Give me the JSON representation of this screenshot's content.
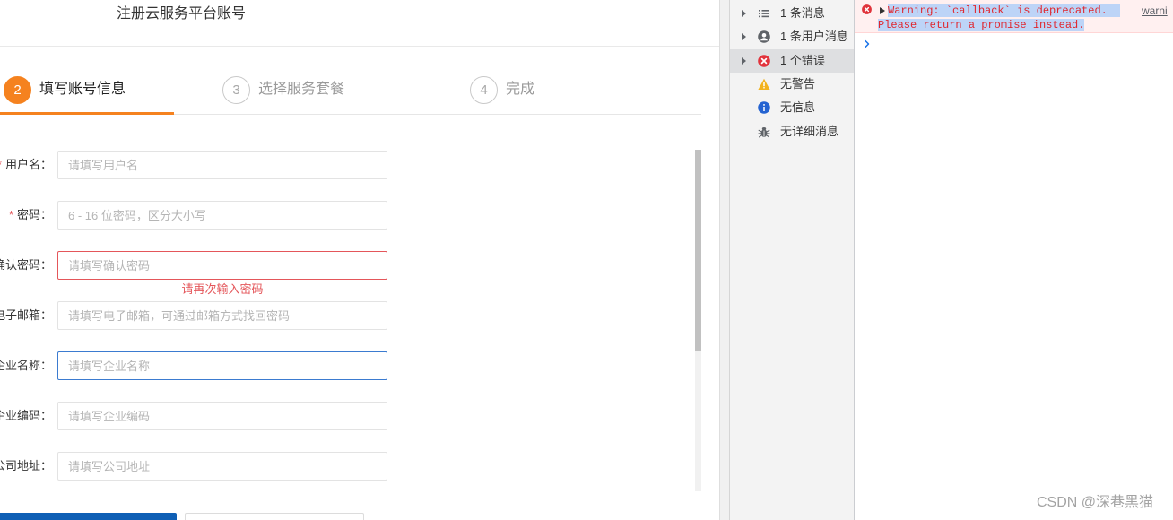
{
  "register": {
    "title": "注册云服务平台账号",
    "steps": [
      {
        "number": "2",
        "label": "填写账号信息",
        "active": true
      },
      {
        "number": "3",
        "label": "选择服务套餐",
        "active": false
      },
      {
        "number": "4",
        "label": "完成",
        "active": false
      }
    ],
    "required_mark": "*",
    "fields": [
      {
        "label": "用户名：",
        "required": true,
        "placeholder": "请填写用户名",
        "value": "",
        "has_error": false,
        "focused": false
      },
      {
        "label": "密码：",
        "required": true,
        "placeholder": "6 - 16 位密码，区分大小写",
        "value": "",
        "has_error": false,
        "focused": false
      },
      {
        "label": "确认密码：",
        "required": false,
        "placeholder": "请填写确认密码",
        "value": "",
        "has_error": true,
        "focused": false,
        "error_text": "请再次输入密码"
      },
      {
        "label": "电子邮箱：",
        "required": false,
        "placeholder": "请填写电子邮箱，可通过邮箱方式找回密码",
        "value": "",
        "has_error": false,
        "focused": false
      },
      {
        "label": "企业名称：",
        "required": false,
        "placeholder": "请填写企业名称",
        "value": "",
        "has_error": false,
        "focused": true
      },
      {
        "label": "企业编码：",
        "required": false,
        "placeholder": "请填写企业编码",
        "value": "",
        "has_error": false,
        "focused": false
      },
      {
        "label": "公司地址：",
        "required": false,
        "placeholder": "请填写公司地址",
        "value": "",
        "has_error": false,
        "focused": false
      }
    ]
  },
  "devtools": {
    "sidebar": [
      {
        "label": "1 条消息",
        "icon": "list-icon",
        "expandable": true,
        "selected": false
      },
      {
        "label": "1 条用户消息",
        "icon": "user-icon",
        "expandable": true,
        "selected": false
      },
      {
        "label": "1 个错误",
        "icon": "error-icon",
        "expandable": true,
        "selected": true
      },
      {
        "label": "无警告",
        "icon": "warning-icon",
        "expandable": false,
        "selected": false
      },
      {
        "label": "无信息",
        "icon": "info-icon",
        "expandable": false,
        "selected": false
      },
      {
        "label": "无详细消息",
        "icon": "bug-icon",
        "expandable": false,
        "selected": false
      }
    ],
    "console": {
      "messages": [
        {
          "level_icon": "error-icon",
          "lines": [
            "Warning: `callback` is deprecated.",
            "Please return a promise instead."
          ],
          "source": "warni",
          "text_selected": true
        }
      ],
      "prompt_icon": "chevron-right-icon"
    }
  },
  "watermark": "CSDN @深巷黑猫",
  "colors": {
    "accent": "#f5821f",
    "error": "#e4565a",
    "focus": "#3b7bd0",
    "primary": "#0f5fb5",
    "consoleError": "#e0262e",
    "selection": "#bdd4f7",
    "link": "#5a5f66"
  }
}
